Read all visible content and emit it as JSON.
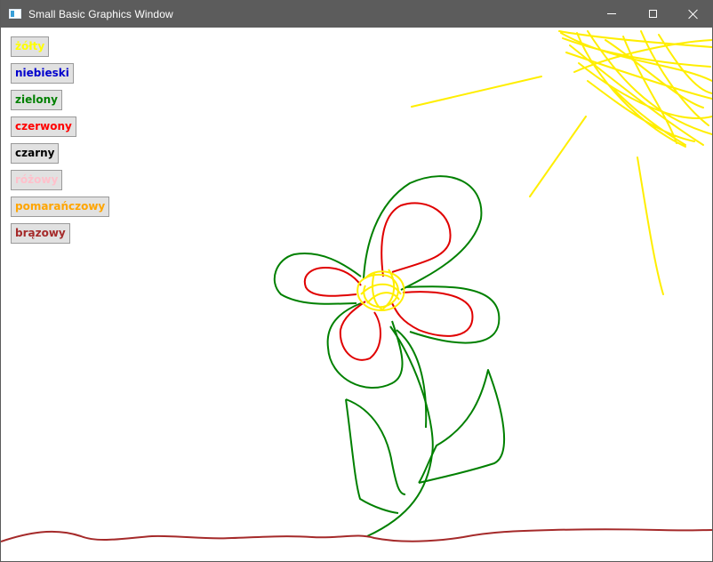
{
  "window": {
    "title": "Small Basic Graphics Window",
    "icon": "app-icon",
    "controls": [
      "minimize-icon",
      "maximize-icon",
      "close-icon"
    ]
  },
  "palette": {
    "buttons": [
      {
        "label": "żółty",
        "color": "#FFFF00"
      },
      {
        "label": "niebieski",
        "color": "#0000CD"
      },
      {
        "label": "zielony",
        "color": "#008000"
      },
      {
        "label": "czerwony",
        "color": "#FF0000"
      },
      {
        "label": "czarny",
        "color": "#000000"
      },
      {
        "label": "różowy",
        "color": "#FFC0CB"
      },
      {
        "label": "pomarańczowy",
        "color": "#FFA500"
      },
      {
        "label": "brązowy",
        "color": "#A52A2A"
      }
    ]
  },
  "drawing_colors": {
    "sun": "#FFEE00",
    "petals_outer": "#008000",
    "petals_inner": "#E00000",
    "stem": "#008000",
    "ground": "#A52A2A"
  }
}
